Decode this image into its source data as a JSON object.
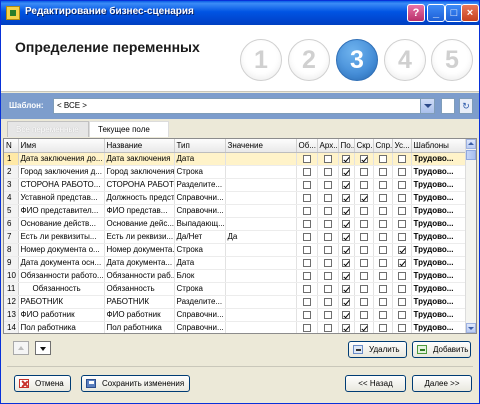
{
  "window": {
    "title": "Редактирование бизнес-сценария"
  },
  "header": {
    "step_title": "Определение переменных",
    "steps": [
      "1",
      "2",
      "3",
      "4",
      "5"
    ],
    "active_step": 3
  },
  "template": {
    "label": "Шаблон:",
    "value": "< ВСЕ >"
  },
  "tabs": [
    {
      "label": "Все переменные"
    },
    {
      "label": "Текущее поле"
    }
  ],
  "grid": {
    "columns": [
      "N",
      "Имя",
      "Название",
      "Тип",
      "Значение",
      "Об...",
      "Арх...",
      "По...",
      "Скр...",
      "Спр...",
      "Ус...",
      "Шаблоны"
    ],
    "rows": [
      {
        "n": "1",
        "name": "Дата заключения до...",
        "title": "Дата заключения",
        "type": "Дата",
        "value": "",
        "c": [
          false,
          false,
          true,
          true,
          false,
          false
        ],
        "tpl": "Трудово..."
      },
      {
        "n": "2",
        "name": "Город заключения д...",
        "title": "Город заключения",
        "type": "Строка",
        "value": "",
        "c": [
          false,
          false,
          true,
          false,
          false,
          false
        ],
        "tpl": "Трудово..."
      },
      {
        "n": "3",
        "name": "СТОРОНА РАБОТО...",
        "title": "СТОРОНА РАБОТО...",
        "type": "Разделите...",
        "value": "",
        "c": [
          false,
          false,
          true,
          false,
          false,
          false
        ],
        "tpl": "Трудово..."
      },
      {
        "n": "4",
        "name": "Уставной представ...",
        "title": "Должность предст...",
        "type": "Справочни...",
        "value": "",
        "c": [
          false,
          false,
          true,
          true,
          false,
          false
        ],
        "tpl": "Трудово..."
      },
      {
        "n": "5",
        "name": "ФИО представител...",
        "title": "ФИО представ...",
        "type": "Справочни...",
        "value": "",
        "c": [
          false,
          false,
          true,
          false,
          false,
          false
        ],
        "tpl": "Трудово..."
      },
      {
        "n": "6",
        "name": "Основание действ...",
        "title": "Основание дейс...",
        "type": "Выпадающ...",
        "value": "",
        "c": [
          false,
          false,
          true,
          false,
          false,
          false
        ],
        "tpl": "Трудово..."
      },
      {
        "n": "7",
        "name": "Есть ли реквизиты...",
        "title": "Есть ли реквизи...",
        "type": "Да/Нет",
        "value": "Да",
        "c": [
          false,
          false,
          true,
          false,
          false,
          false
        ],
        "tpl": "Трудово..."
      },
      {
        "n": "8",
        "name": "Номер документа о...",
        "title": "Номер документа...",
        "type": "Строка",
        "value": "",
        "c": [
          false,
          false,
          true,
          false,
          false,
          true
        ],
        "tpl": "Трудово..."
      },
      {
        "n": "9",
        "name": "Дата документа осн...",
        "title": "Дата документа...",
        "type": "Дата",
        "value": "",
        "c": [
          false,
          false,
          true,
          false,
          false,
          true
        ],
        "tpl": "Трудово..."
      },
      {
        "n": "10",
        "name": "Обязанности работо...",
        "title": "Обязанности раб...",
        "type": "Блок",
        "value": "",
        "c": [
          false,
          false,
          true,
          false,
          false,
          false
        ],
        "tpl": "Трудово..."
      },
      {
        "n": "11",
        "name": "Обязанность",
        "title": "Обязанность",
        "type": "Строка",
        "value": "",
        "c": [
          false,
          false,
          true,
          false,
          false,
          false
        ],
        "tpl": "Трудово..."
      },
      {
        "n": "12",
        "name": "РАБОТНИК",
        "title": "РАБОТНИК",
        "type": "Разделите...",
        "value": "",
        "c": [
          false,
          false,
          true,
          false,
          false,
          false
        ],
        "tpl": "Трудово..."
      },
      {
        "n": "13",
        "name": "ФИО работник",
        "title": "ФИО работник",
        "type": "Справочни...",
        "value": "",
        "c": [
          false,
          false,
          true,
          false,
          false,
          false
        ],
        "tpl": "Трудово..."
      },
      {
        "n": "14",
        "name": "Пол работника",
        "title": "Пол работника",
        "type": "Справочни...",
        "value": "",
        "c": [
          false,
          false,
          true,
          true,
          false,
          false
        ],
        "tpl": "Трудово..."
      }
    ]
  },
  "buttons": {
    "delete": "Удалить",
    "add": "Добавить",
    "cancel": "Отмена",
    "save": "Сохранить изменения",
    "back": "<< Назад",
    "next": "Далее >>"
  }
}
